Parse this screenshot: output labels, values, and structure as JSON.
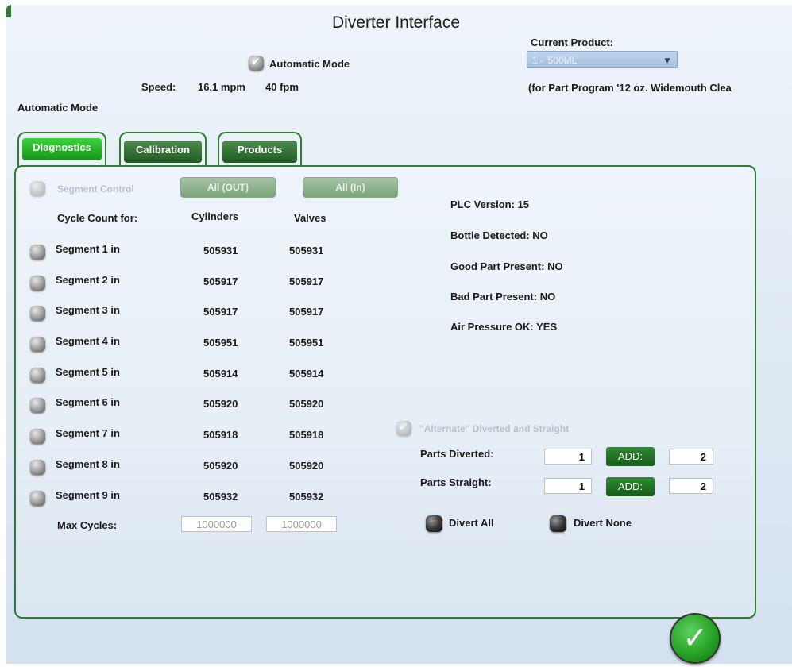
{
  "window": {
    "title": "Diverter Interface"
  },
  "header": {
    "automatic_mode_checkbox_label": "Automatic Mode",
    "speed_label": "Speed:",
    "speed_mpm": "16.1 mpm",
    "speed_fpm": "40 fpm",
    "mode_status": "Automatic Mode",
    "current_product_label": "Current Product:",
    "current_product_value": "1 - '500ML'",
    "part_program_note": "(for Part Program '12 oz. Widemouth Clea"
  },
  "tabs": [
    {
      "label": "Diagnostics",
      "active": true
    },
    {
      "label": "Calibration",
      "active": false
    },
    {
      "label": "Products",
      "active": false
    }
  ],
  "diagnostics": {
    "segment_control_label": "Segment Control",
    "all_out_label": "All (OUT)",
    "all_in_label": "All (In)",
    "cycle_count_header": "Cycle Count for:",
    "cylinders_header": "Cylinders",
    "valves_header": "Valves",
    "segments": [
      {
        "label": "Segment 1 in",
        "cylinders": "505931",
        "valves": "505931"
      },
      {
        "label": "Segment 2 in",
        "cylinders": "505917",
        "valves": "505917"
      },
      {
        "label": "Segment 3 in",
        "cylinders": "505917",
        "valves": "505917"
      },
      {
        "label": "Segment 4 in",
        "cylinders": "505951",
        "valves": "505951"
      },
      {
        "label": "Segment 5 in",
        "cylinders": "505914",
        "valves": "505914"
      },
      {
        "label": "Segment 6 in",
        "cylinders": "505920",
        "valves": "505920"
      },
      {
        "label": "Segment 7 in",
        "cylinders": "505918",
        "valves": "505918"
      },
      {
        "label": "Segment 8 in",
        "cylinders": "505920",
        "valves": "505920"
      },
      {
        "label": "Segment 9 in",
        "cylinders": "505932",
        "valves": "505932"
      }
    ],
    "max_cycles_label": "Max Cycles:",
    "max_cycles_cylinders": "1000000",
    "max_cycles_valves": "1000000",
    "status": {
      "plc_version": "PLC Version: 15",
      "bottle_detected": "Bottle Detected: NO",
      "good_part": "Good Part Present: NO",
      "bad_part": "Bad Part Present: NO",
      "air_pressure": "Air Pressure OK: YES"
    },
    "alternate_label": "\"Alternate\" Diverted and Straight",
    "parts_diverted_label": "Parts Diverted:",
    "parts_diverted_value": "1",
    "parts_diverted_add_label": "ADD:",
    "parts_diverted_add_value": "2",
    "parts_straight_label": "Parts Straight:",
    "parts_straight_value": "1",
    "parts_straight_add_label": "ADD:",
    "parts_straight_add_value": "2",
    "divert_all_label": "Divert All",
    "divert_none_label": "Divert None"
  }
}
